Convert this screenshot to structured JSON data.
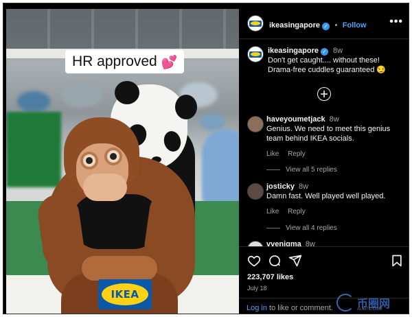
{
  "photo": {
    "overlay_text": "HR approved",
    "overlay_emoji": "💕",
    "tag_text": "IKEA"
  },
  "header": {
    "username": "ikeasingapore",
    "follow_label": "Follow",
    "separator": "•",
    "more_icon": "more-horizontal-icon"
  },
  "caption": {
    "username": "ikeasingapore",
    "time": "8w",
    "text": "Don't get caught.... without these! Drama-free cuddles guaranteed 😏"
  },
  "comments": [
    {
      "username": "haveyoumetjack",
      "time": "8w",
      "text": "Genius. We need to meet this genius team behind IKEA socials.",
      "like_label": "Like",
      "reply_label": "Reply",
      "view_replies": "View all 5 replies"
    },
    {
      "username": "josticky",
      "time": "8w",
      "text": "Damn fast. Well played well played.",
      "like_label": "Like",
      "reply_label": "Reply",
      "view_replies": "View all 4 replies"
    },
    {
      "username": "vvenigma",
      "time": "8w"
    }
  ],
  "actions": {
    "likes": "223,707 likes",
    "date": "July 18",
    "login_link": "Log in",
    "login_rest": " to like or comment."
  },
  "watermark": {
    "text": "币圈网",
    "sub": "ALIBTC.COM"
  },
  "colors": {
    "ikea_blue": "#0a58a8",
    "ikea_yellow": "#fcd116",
    "link_blue": "#4aa3f5",
    "background": "#000000"
  }
}
